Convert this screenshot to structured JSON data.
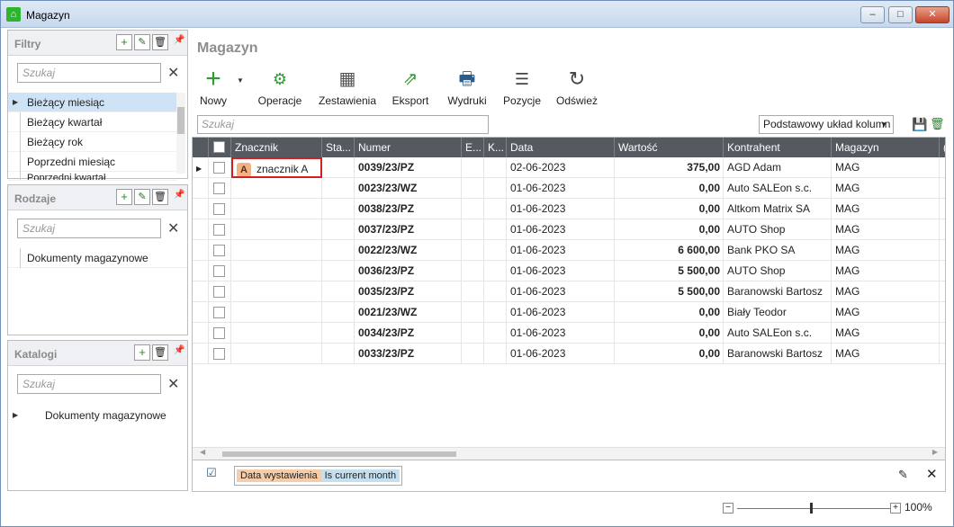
{
  "window": {
    "title": "Magazyn",
    "min": "–",
    "max": "□",
    "close": "✕"
  },
  "filtry": {
    "title": "Filtry",
    "search_placeholder": "Szukaj",
    "items": [
      "Bieżący miesiąc",
      "Bieżący kwartał",
      "Bieżący rok",
      "Poprzedni miesiąc",
      "Poprzedni kwartał"
    ]
  },
  "rodzaje": {
    "title": "Rodzaje",
    "search_placeholder": "Szukaj",
    "items": [
      "Dokumenty magazynowe"
    ]
  },
  "katalogi": {
    "title": "Katalogi",
    "search_placeholder": "Szukaj",
    "items": [
      "Dokumenty magazynowe"
    ]
  },
  "main": {
    "title": "Magazyn",
    "toolbar": {
      "nowy": "Nowy",
      "operacje": "Operacje",
      "zestawienia": "Zestawienia",
      "eksport": "Eksport",
      "wydruki": "Wydruki",
      "pozycje": "Pozycje",
      "odswiez": "Odśwież"
    },
    "search_placeholder": "Szukaj",
    "layout_select": "Podstawowy układ kolumn"
  },
  "grid": {
    "columns": [
      "Znacznik",
      "Sta...",
      "Numer",
      "E...",
      "K...",
      "Data",
      "Wartość",
      "Kontrahent",
      "Magazyn",
      "("
    ],
    "rows": [
      {
        "znacznik_badge": "A",
        "znacznik": "znacznik A",
        "numer": "0039/23/PZ",
        "data": "02-06-2023",
        "wartosc": "375,00",
        "kontrahent": "AGD Adam",
        "magazyn": "MAG"
      },
      {
        "znacznik_badge": "",
        "znacznik": "",
        "numer": "0023/23/WZ",
        "data": "01-06-2023",
        "wartosc": "0,00",
        "kontrahent": "Auto SALEon s.c.",
        "magazyn": "MAG"
      },
      {
        "znacznik_badge": "",
        "znacznik": "",
        "numer": "0038/23/PZ",
        "data": "01-06-2023",
        "wartosc": "0,00",
        "kontrahent": "Altkom Matrix SA",
        "magazyn": "MAG"
      },
      {
        "znacznik_badge": "",
        "znacznik": "",
        "numer": "0037/23/PZ",
        "data": "01-06-2023",
        "wartosc": "0,00",
        "kontrahent": "AUTO Shop",
        "magazyn": "MAG"
      },
      {
        "znacznik_badge": "",
        "znacznik": "",
        "numer": "0022/23/WZ",
        "data": "01-06-2023",
        "wartosc": "6 600,00",
        "kontrahent": "Bank PKO SA",
        "magazyn": "MAG"
      },
      {
        "znacznik_badge": "",
        "znacznik": "",
        "numer": "0036/23/PZ",
        "data": "01-06-2023",
        "wartosc": "5 500,00",
        "kontrahent": "AUTO Shop",
        "magazyn": "MAG"
      },
      {
        "znacznik_badge": "",
        "znacznik": "",
        "numer": "0035/23/PZ",
        "data": "01-06-2023",
        "wartosc": "5 500,00",
        "kontrahent": "Baranowski Bartosz",
        "magazyn": "MAG"
      },
      {
        "znacznik_badge": "",
        "znacznik": "",
        "numer": "0021/23/WZ",
        "data": "01-06-2023",
        "wartosc": "0,00",
        "kontrahent": "Biały Teodor",
        "magazyn": "MAG"
      },
      {
        "znacznik_badge": "",
        "znacznik": "",
        "numer": "0034/23/PZ",
        "data": "01-06-2023",
        "wartosc": "0,00",
        "kontrahent": "Auto SALEon s.c.",
        "magazyn": "MAG"
      },
      {
        "znacznik_badge": "",
        "znacznik": "",
        "numer": "0033/23/PZ",
        "data": "01-06-2023",
        "wartosc": "0,00",
        "kontrahent": "Baranowski Bartosz",
        "magazyn": "MAG"
      }
    ]
  },
  "footer": {
    "filter_field": "Data wystawienia",
    "filter_value": "Is current month"
  },
  "zoom": {
    "level": "100%",
    "minus": "−",
    "plus": "+"
  },
  "colors": {
    "grid_header": "#555a60",
    "selection": "#cfe3f7",
    "tag_orange": "#f1b184",
    "filter_blue": "#c4dff0"
  }
}
